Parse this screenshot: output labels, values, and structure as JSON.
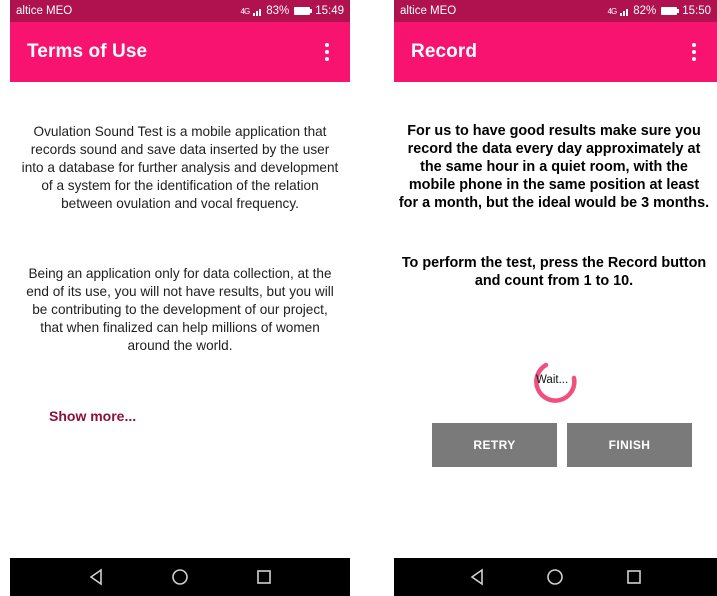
{
  "screens": {
    "terms": {
      "status": {
        "carrier": "altice MEO",
        "signal": "4G",
        "battery": "83%",
        "time": "15:49"
      },
      "appbar": {
        "title": "Terms of Use"
      },
      "paragraphs": [
        "Ovulation Sound Test is a mobile application that records sound and save data inserted by the user into a database for further analysis and development of a system for the identification of the relation between ovulation and vocal frequency.",
        "Being an application only for data collection, at the end of its use, you will not have results, but you will be contributing to the development of our project, that when finalized can help millions of women around the world."
      ],
      "show_more": "Show more..."
    },
    "record": {
      "status": {
        "carrier": "altice MEO",
        "signal": "4G",
        "battery": "82%",
        "time": "15:50"
      },
      "appbar": {
        "title": "Record"
      },
      "paragraphs": [
        "For us to have good results make sure you record the data every day approximately at the same hour in a quiet room, with the mobile phone in the same position at least for a month, but the ideal would be 3 months.",
        "To perform the test, press the Record button and count from 1 to 10."
      ],
      "spinner_label": "Wait...",
      "buttons": {
        "retry": "RETRY",
        "finish": "FINISH"
      }
    }
  },
  "navbar": {
    "icons": [
      "back-icon",
      "home-icon",
      "recents-icon"
    ]
  },
  "colors": {
    "status_bar": "#b0114f",
    "app_bar": "#f7136f",
    "link": "#8c1038",
    "spinner": "#f0507e",
    "button": "#7a7a7a"
  }
}
